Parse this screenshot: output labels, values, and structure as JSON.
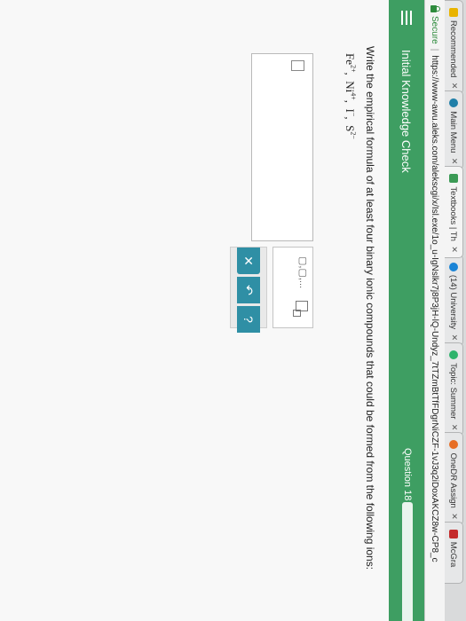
{
  "tabs": [
    {
      "label": "Recommended",
      "color": "#e9b400"
    },
    {
      "label": "Main Menu",
      "color": "#1f7fa8"
    },
    {
      "label": "Textbooks | Th",
      "color": "#3b9a55"
    },
    {
      "label": "(14) University",
      "color": "#1a84d6"
    },
    {
      "label": "Topic: Summer",
      "color": "#2db36b"
    },
    {
      "label": "OneDR Assign",
      "color": "#e76e25"
    },
    {
      "label": "McGra",
      "color": "#c42b2b"
    }
  ],
  "address": {
    "secure": "Secure",
    "url": "https://www-awu.aleks.com/alekscgi/x/Isl.exe/1o_u-IgNslkr7j8P3jH-lQ-Undyz_7tTZmBtTfFDgrNiCZF-1vJ3q2iDoxAKCZ8w-CP8_c"
  },
  "header": {
    "title": "Initial Knowledge Check",
    "question": "Question 18",
    "progress": 1.0
  },
  "problem": {
    "prompt": "Write the empirical formula of at least four binary ionic compounds that could be formed from the following ions:",
    "ions": [
      {
        "base": "Fe",
        "charge": "2+"
      },
      {
        "base": "Ni",
        "charge": "4+"
      },
      {
        "base": "I",
        "charge": "−"
      },
      {
        "base": "S",
        "charge": "2−"
      }
    ]
  },
  "palette": {
    "header_bg": "#3e9e62",
    "button_bg": "#2f8fa5"
  }
}
